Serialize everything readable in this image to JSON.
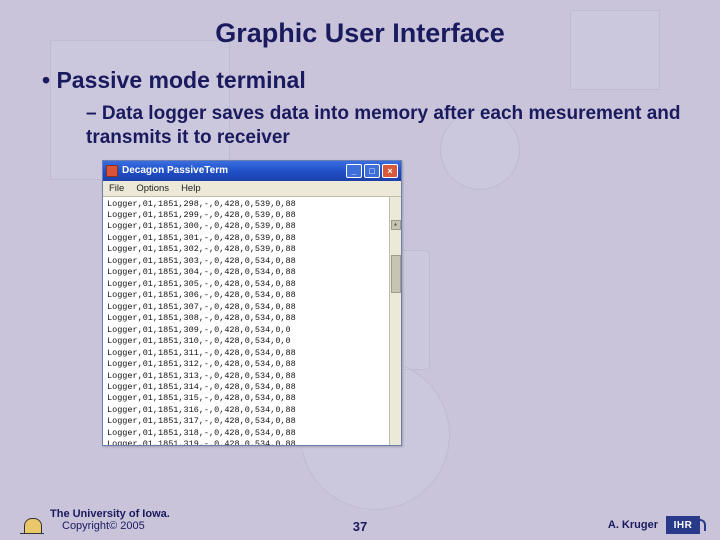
{
  "title": "Graphic User Interface",
  "bullets": {
    "l1": "•  Passive mode terminal",
    "l2": "– Data logger saves data into memory after each mesurement and transmits it to receiver"
  },
  "window": {
    "title": "Decagon PassiveTerm",
    "menu": {
      "file": "File",
      "options": "Options",
      "help": "Help"
    },
    "btn": {
      "min": "_",
      "max": "□",
      "close": "×"
    },
    "lines": [
      "Logger,01,1851,298,-,0,428,0,539,0,88",
      "Logger,01,1851,299,-,0,428,0,539,0,88",
      "Logger,01,1851,300,-,0,428,0,539,0,88",
      "Logger,01,1851,301,-,0,428,0,539,0,88",
      "Logger,01,1851,302,-,0,428,0,539,0,88",
      "Logger,01,1851,303,-,0,428,0,534,0,88",
      "Logger,01,1851,304,-,0,428,0,534,0,88",
      "Logger,01,1851,305,-,0,428,0,534,0,88",
      "Logger,01,1851,306,-,0,428,0,534,0,88",
      "Logger,01,1851,307,-,0,428,0,534,0,88",
      "Logger,01,1851,308,-,0,428,0,534,0,88",
      "Logger,01,1851,309,-,0,428,0,534,0,0",
      "Logger,01,1851,310,-,0,428,0,534,0,0",
      "Logger,01,1851,311,-,0,428,0,534,0,88",
      "Logger,01,1851,312,-,0,428,0,534,0,88",
      "Logger,01,1851,313,-,0,428,0,534,0,88",
      "Logger,01,1851,314,-,0,428,0,534,0,88",
      "Logger,01,1851,315,-,0,428,0,534,0,88",
      "Logger,01,1851,316,-,0,428,0,534,0,88",
      "Logger,01,1851,317,-,0,428,0,534,0,88",
      "Logger,01,1851,318,-,0,428,0,534,0,88",
      "Logger,01,1851,319,-,0,428,0,534,0,88"
    ]
  },
  "footer": {
    "org": "The University of Iowa.",
    "copyright": "Copyright© 2005",
    "page": "37",
    "author": "A. Kruger",
    "logo_right_text": "IHR"
  }
}
